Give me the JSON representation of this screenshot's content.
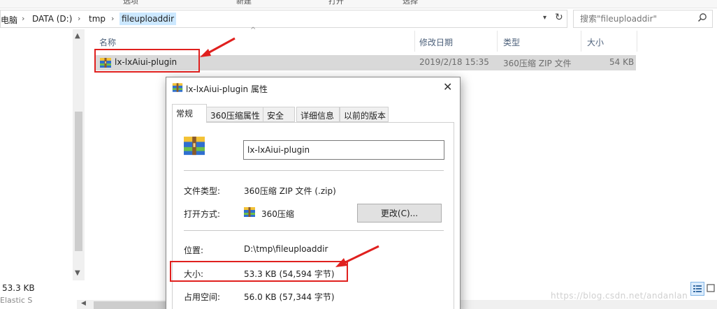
{
  "ribbon": {
    "items": [
      "选项",
      "新建",
      "打开",
      "选择"
    ]
  },
  "address": {
    "crumbs": [
      "电脑",
      "DATA (D:)",
      "tmp",
      "fileuploaddir"
    ]
  },
  "search": {
    "placeholder": "搜索\"fileuploaddir\""
  },
  "columns": {
    "name": "名称",
    "date": "修改日期",
    "type": "类型",
    "size": "大小"
  },
  "file": {
    "name": "lx-lxAiui-plugin",
    "date": "2019/2/18 15:35",
    "type": "360压缩 ZIP 文件",
    "size": "54 KB"
  },
  "status": {
    "size_text": "53.3 KB",
    "sub_text": "Elastic S"
  },
  "watermark": "https://blog.csdn.net/andanlan",
  "dialog": {
    "title": "lx-lxAiui-plugin 属性",
    "tabs": [
      "常规",
      "360压缩属性",
      "安全",
      "详细信息",
      "以前的版本"
    ],
    "filename": "lx-lxAiui-plugin",
    "file_type_label": "文件类型:",
    "file_type_value": "360压缩 ZIP 文件 (.zip)",
    "open_with_label": "打开方式:",
    "open_with_value": "360压缩",
    "change_button": "更改(C)...",
    "location_label": "位置:",
    "location_value": "D:\\tmp\\fileuploaddir",
    "size_label": "大小:",
    "size_value": "53.3 KB (54,594 字节)",
    "disk_size_label": "占用空间:",
    "disk_size_value": "56.0 KB (57,344 字节)"
  },
  "colors": {
    "highlight_red": "#e0201e",
    "selection_gray": "#d9d9d9",
    "crumb_blue": "#cce8ff"
  }
}
